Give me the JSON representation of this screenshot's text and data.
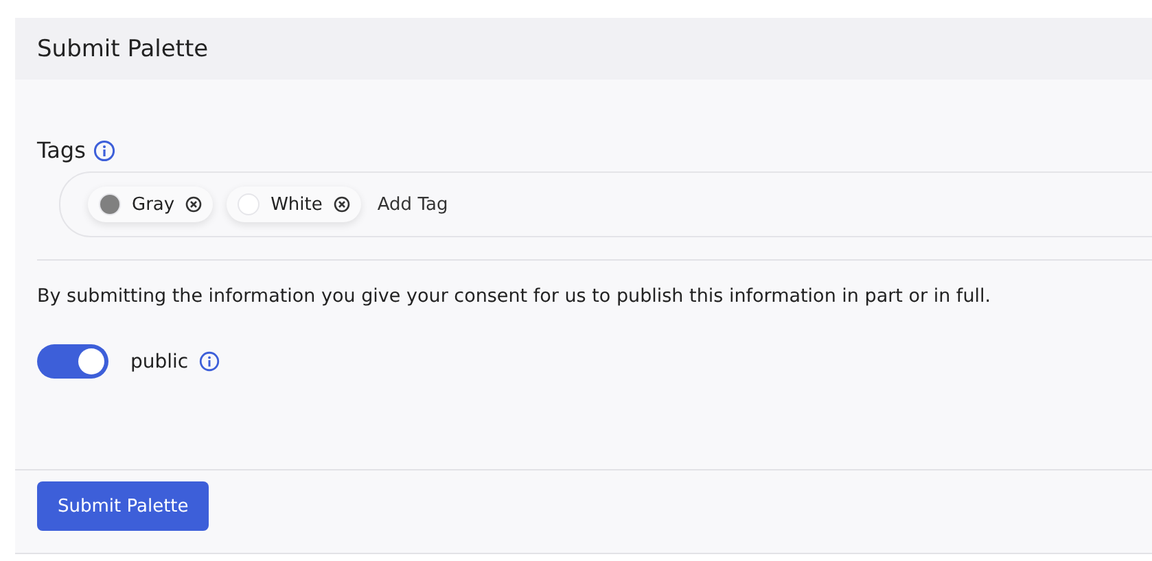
{
  "header": {
    "title": "Submit Palette"
  },
  "tags": {
    "label": "Tags",
    "items": [
      {
        "name": "Gray",
        "color": "#808080"
      },
      {
        "name": "White",
        "color": "#ffffff"
      }
    ],
    "input": {
      "placeholder": "Add Tag"
    }
  },
  "consent": "By submitting the information you give your consent for us to publish this information in part or in full.",
  "public_toggle": {
    "label": "public",
    "on": true
  },
  "submit_button": "Submit Palette"
}
